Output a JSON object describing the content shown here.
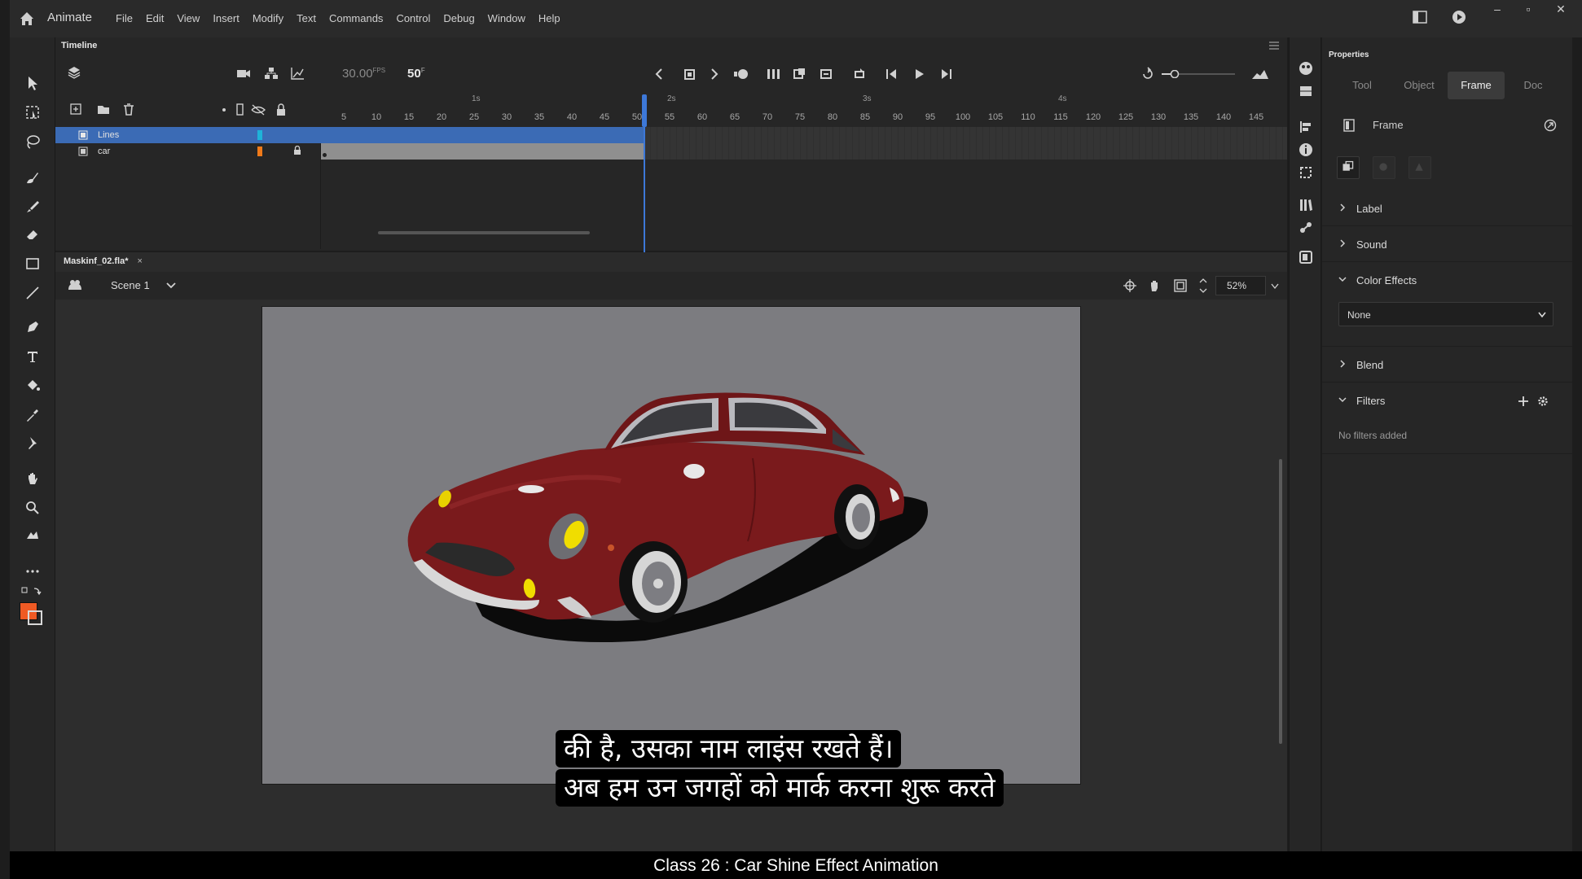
{
  "app": {
    "name": "Animate",
    "menu": [
      "File",
      "Edit",
      "View",
      "Insert",
      "Modify",
      "Text",
      "Commands",
      "Control",
      "Debug",
      "Window",
      "Help"
    ]
  },
  "timeline": {
    "title": "Timeline",
    "fps": "30.00",
    "fps_unit": "FPS",
    "current_frame": "50",
    "frame_unit": "F",
    "seconds": [
      "1s",
      "2s",
      "3s",
      "4s"
    ],
    "ruler": [
      "5",
      "10",
      "15",
      "20",
      "25",
      "30",
      "35",
      "40",
      "45",
      "50",
      "55",
      "60",
      "65",
      "70",
      "75",
      "80",
      "85",
      "90",
      "95",
      "100",
      "105",
      "110",
      "115",
      "120",
      "125",
      "130",
      "135",
      "140",
      "145"
    ],
    "layers": [
      {
        "name": "Lines",
        "color": "#1fb3d8",
        "selected": true
      },
      {
        "name": "car",
        "color": "#f07a1a",
        "selected": false,
        "locked": true
      }
    ]
  },
  "document": {
    "tab": "Maskinf_02.fla*",
    "scene": "Scene 1",
    "zoom": "52%"
  },
  "properties": {
    "title": "Properties",
    "tabs": [
      "Tool",
      "Object",
      "Frame",
      "Doc"
    ],
    "active_tab": "Frame",
    "frame_label": "Frame",
    "sections": {
      "label": "Label",
      "sound": "Sound",
      "color_effects": "Color Effects",
      "color_effect_value": "None",
      "blend": "Blend",
      "filters": "Filters",
      "filters_empty": "No filters added"
    }
  },
  "colors": {
    "stroke": "#000000",
    "fill": "#ef5a24",
    "car_body": "#7a1a1c",
    "stage": "#7c7c80",
    "selection": "#3b6bb5"
  },
  "subtitles": [
    "की है, उसका नाम लाइंस रखते हैं।",
    "अब हम उन जगहों को मार्क करना शुरू करते"
  ],
  "footer": "Class 26 : Car Shine Effect Animation"
}
